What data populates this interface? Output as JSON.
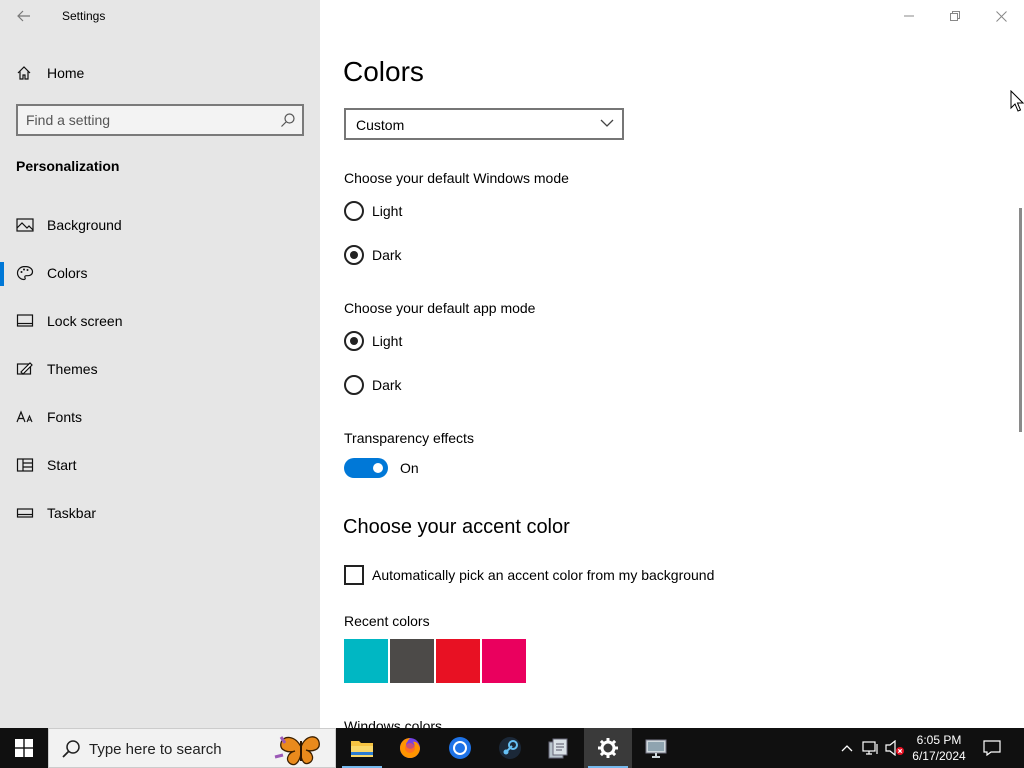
{
  "window": {
    "app_title": "Settings"
  },
  "sidebar": {
    "home_label": "Home",
    "search_placeholder": "Find a setting",
    "section_title": "Personalization",
    "items": [
      {
        "label": "Background",
        "icon": "image-icon",
        "active": false
      },
      {
        "label": "Colors",
        "icon": "palette-icon",
        "active": true
      },
      {
        "label": "Lock screen",
        "icon": "lock-screen-icon",
        "active": false
      },
      {
        "label": "Themes",
        "icon": "brush-icon",
        "active": false
      },
      {
        "label": "Fonts",
        "icon": "font-icon",
        "active": false
      },
      {
        "label": "Start",
        "icon": "start-layout-icon",
        "active": false
      },
      {
        "label": "Taskbar",
        "icon": "taskbar-icon",
        "active": false
      }
    ]
  },
  "main": {
    "title": "Colors",
    "color_dropdown": {
      "value": "Custom"
    },
    "windows_mode": {
      "label": "Choose your default Windows mode",
      "options": [
        "Light",
        "Dark"
      ],
      "selected": "Dark"
    },
    "app_mode": {
      "label": "Choose your default app mode",
      "options": [
        "Light",
        "Dark"
      ],
      "selected": "Light"
    },
    "transparency": {
      "label": "Transparency effects",
      "state": "On"
    },
    "accent": {
      "title": "Choose your accent color",
      "auto_pick_label": "Automatically pick an accent color from my background",
      "auto_pick_checked": false,
      "recent_label": "Recent colors",
      "recent_colors": [
        "#00b7c3",
        "#4c4a48",
        "#e81123",
        "#ea005e"
      ],
      "windows_colors_label": "Windows colors"
    }
  },
  "taskbar": {
    "search_placeholder": "Type here to search",
    "apps": [
      "file-explorer-icon",
      "firefox-icon",
      "chrome-icon",
      "steam-icon",
      "files-app-icon",
      "settings-icon",
      "display-app-icon"
    ],
    "active_app": "settings-icon",
    "time": "6:05 PM",
    "date": "6/17/2024"
  },
  "colors": {
    "accent": "#0078d7",
    "sidebar_bg": "#e6e6e6",
    "taskbar_bg": "#101010"
  }
}
